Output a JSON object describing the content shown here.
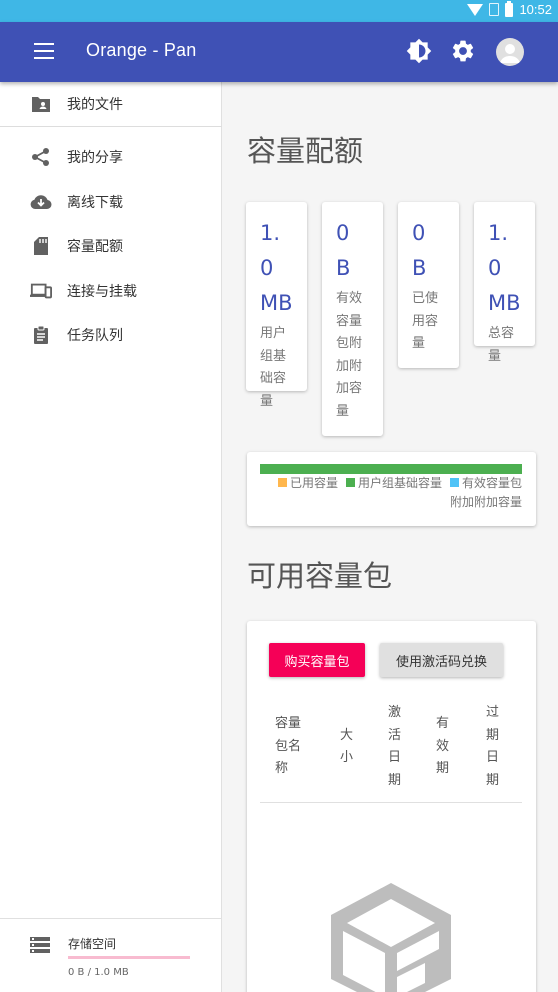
{
  "status_bar": {
    "time": "10:52"
  },
  "app_bar": {
    "title": "Orange - Pan"
  },
  "drawer": {
    "items": [
      {
        "label": "我的文件",
        "icon": "folder-account-icon"
      },
      {
        "label": "我的分享",
        "icon": "share-icon"
      },
      {
        "label": "离线下载",
        "icon": "cloud-download-icon"
      },
      {
        "label": "容量配额",
        "icon": "sd-card-icon"
      },
      {
        "label": "连接与挂载",
        "icon": "devices-icon"
      },
      {
        "label": "任务队列",
        "icon": "clipboard-list-icon"
      }
    ],
    "storage": {
      "title": "存储空间",
      "usage": "0 B / 1.0 MB",
      "used_fraction": 0
    }
  },
  "quota": {
    "title": "容量配额",
    "cards": [
      {
        "value": "1.0 MB",
        "label": "用户组基础容量"
      },
      {
        "value": "0 B",
        "label": "有效容量包附加附加容量"
      },
      {
        "value": "0 B",
        "label": "已使用容量"
      },
      {
        "value": "1.0 MB",
        "label": "总容量"
      }
    ],
    "legend": {
      "used": "已用容量",
      "base": "用户组基础容量",
      "pack": "有效容量包附加附加容量",
      "colors": {
        "used": "#ffb74d",
        "base": "#4caf50",
        "pack": "#4fc3f7"
      }
    }
  },
  "packs": {
    "title": "可用容量包",
    "buy_button": "购买容量包",
    "redeem_button": "使用激活码兑换",
    "columns": [
      "容量包名称",
      "大小",
      "激活日期",
      "有效期",
      "过期日期"
    ],
    "rows": []
  },
  "colors": {
    "primary": "#3f51b5",
    "accent": "#f50057",
    "status_bar": "#3fb7e6"
  }
}
